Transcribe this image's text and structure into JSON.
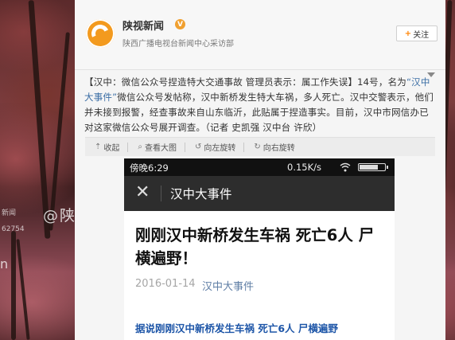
{
  "account": {
    "name": "陕视新闻",
    "verified_badge": "V",
    "description": "陕西广播电视台新闻中心采访部",
    "follow_label": "关注",
    "follow_plus": "+"
  },
  "post": {
    "text_part1": "【汉中：微信公众号捏造特大交通事故  管理员表示：属工作失误】14号，名为",
    "mention": "“汉中大事件”",
    "text_part2": "微信公众号发帖称，汉中新桥发生特大车祸，多人死亡。汉中交警表示，他们并未接到报警，经查事故来自山东临沂，此贴属于捏造事实。目前，汉中市网信办已对这家微信公众号展开调查。（记者 史凯强 汉中台 许欣）"
  },
  "toolbar": {
    "collapse": "收起",
    "view_large": "查看大图",
    "rotate_left": "向左旋转",
    "rotate_right": "向右旋转"
  },
  "phone": {
    "time": "傍晚6:29",
    "speed": "0.15K/s",
    "close_glyph": "✕",
    "nav_title": "汉中大事件",
    "article_title": "刚刚汉中新桥发生车祸 死亡6人 尸横遍野！",
    "article_date": "2016-01-14",
    "article_source": "汉中大事件",
    "article_lead": "据说刚刚汉中新桥发生车祸 死亡6人 尸横遍野"
  },
  "watermarks": {
    "at": "@陕",
    "small_line1": "新闻",
    "small_line2": "62754",
    "left_text": "n"
  },
  "colors": {
    "accent_orange": "#f39a1e",
    "link_blue": "#3b6ea5",
    "nav_bg": "#2d2d2d",
    "lead_blue": "#1e56a8"
  },
  "icons": [
    "weibo-logo-icon",
    "verified-icon",
    "plus-icon",
    "caret-down-icon",
    "collapse-icon",
    "zoom-icon",
    "rotate-left-icon",
    "rotate-right-icon",
    "wifi-icon",
    "battery-icon",
    "close-icon"
  ]
}
